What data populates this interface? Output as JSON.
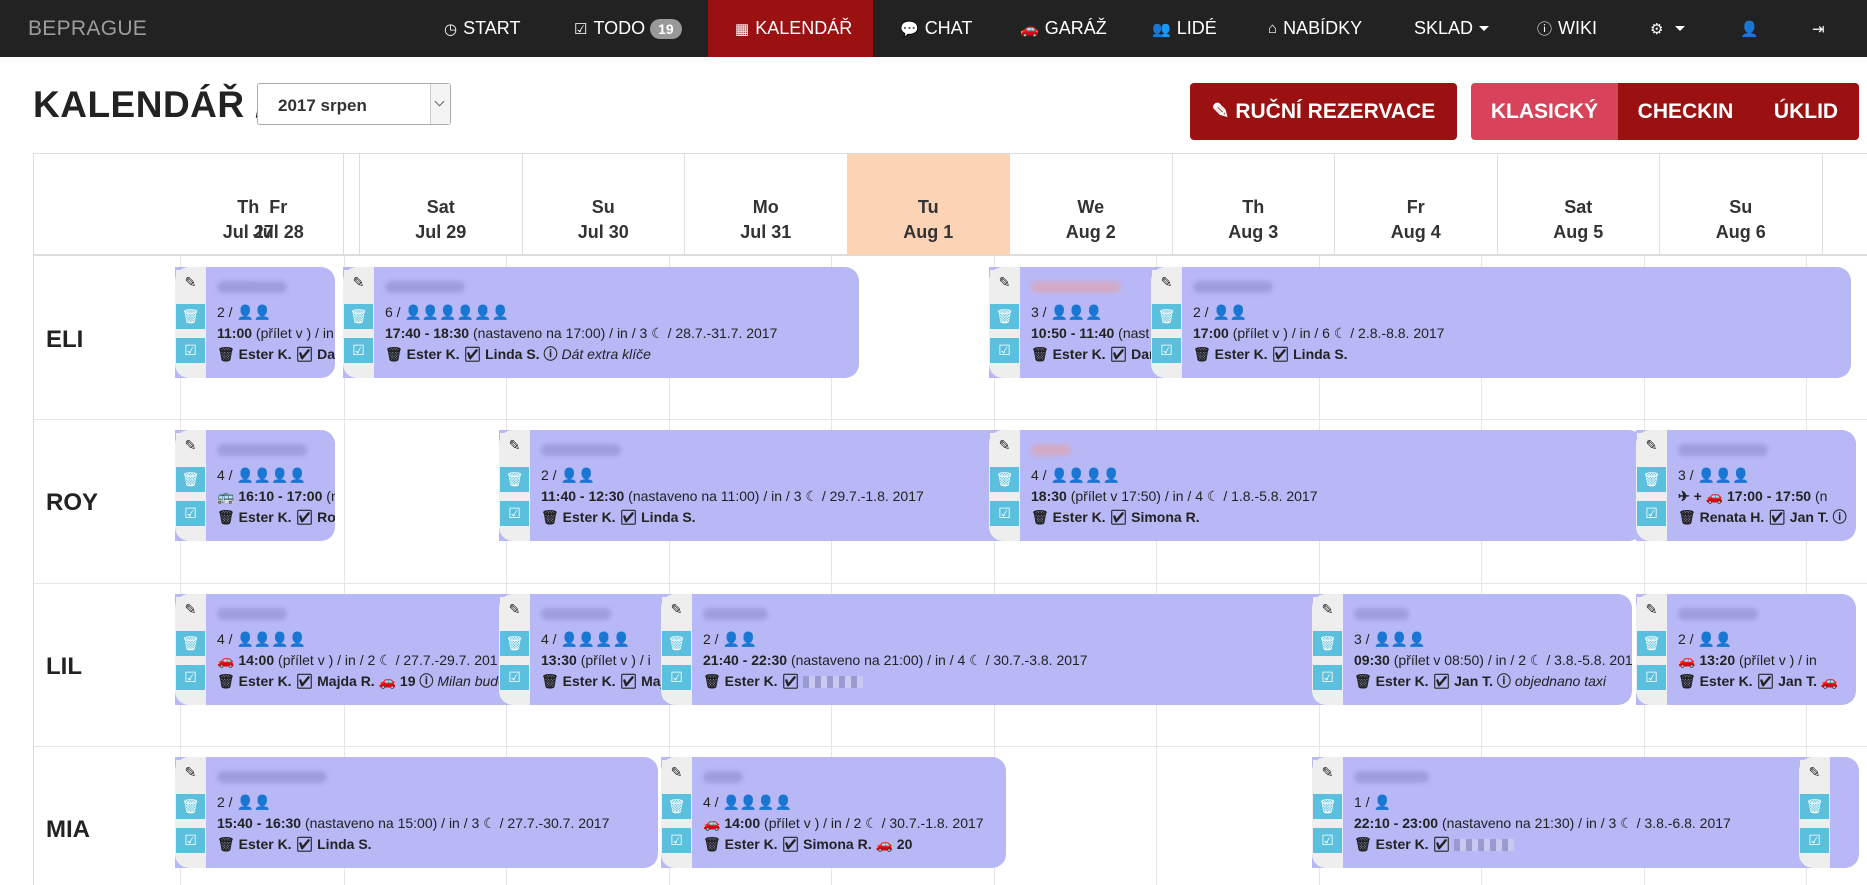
{
  "navbar": {
    "brand": "BEPRAGUE",
    "items": [
      {
        "label": "START",
        "icon": "dashboard-icon",
        "glyph": "◷"
      },
      {
        "label": "TODO",
        "icon": "checkbox-icon",
        "glyph": "☑",
        "badge": "19"
      },
      {
        "label": "KALENDÁŘ",
        "icon": "calendar-icon",
        "glyph": "▦"
      },
      {
        "label": "CHAT",
        "icon": "chat-icon",
        "glyph": "💬"
      },
      {
        "label": "GARÁŽ",
        "icon": "car-icon",
        "glyph": "🚗"
      },
      {
        "label": "LIDÉ",
        "icon": "users-icon",
        "glyph": "👥"
      },
      {
        "label": "NABÍDKY",
        "icon": "home-icon",
        "glyph": "⌂"
      },
      {
        "label": "SKLAD",
        "icon": "",
        "glyph": ""
      },
      {
        "label": "WIKI",
        "icon": "info-icon",
        "glyph": "ⓘ"
      }
    ],
    "settings_glyph": "⚙",
    "user_glyph": "👤",
    "logout_glyph": "⇥"
  },
  "header": {
    "title": "KALENDÁŘ /",
    "month_value": "2017 srpen",
    "manual_reservation": "RUČNÍ REZERVACE",
    "manual_reservation_glyph": "✎",
    "view_classic": "KLASICKÝ",
    "view_checkin": "CHECKIN",
    "view_cleaning": "ÚKLID"
  },
  "days": [
    {
      "dow": "Th",
      "date": "Jul 27"
    },
    {
      "dow": "Fr",
      "date": "Jul 28"
    },
    {
      "dow": "Sat",
      "date": "Jul 29"
    },
    {
      "dow": "Su",
      "date": "Jul 30"
    },
    {
      "dow": "Mo",
      "date": "Jul 31"
    },
    {
      "dow": "Tu",
      "date": "Aug 1"
    },
    {
      "dow": "We",
      "date": "Aug 2"
    },
    {
      "dow": "Th",
      "date": "Aug 3"
    },
    {
      "dow": "Fr",
      "date": "Aug 4"
    },
    {
      "dow": "Sat",
      "date": "Aug 5"
    },
    {
      "dow": "Su",
      "date": "Aug 6"
    }
  ],
  "resources": [
    "ELI",
    "ROY",
    "LIL",
    "MIA"
  ],
  "colors": {
    "booking": "#b8b8f7",
    "accent": "#9b1010",
    "today": "#fdd3b5",
    "action": "#5bc0de"
  },
  "bookings": [
    {
      "row": 0,
      "persons": "2 / 👤👤",
      "time": "11:00",
      "rest": " (přílet v ) / in",
      "staff": "🗑 Ester K. ☑ Darj"
    },
    {
      "row": 0,
      "persons": "6 / 👤👤👤👤👤👤",
      "time": "17:40 - 18:30",
      "rest": " (nastaveno na 17:00) / in / 3 ☾ / 28.7.-31.7. 2017",
      "staff": "🗑 Ester K. ☑ Linda S. ⓘ",
      "note": "Dát extra klíče"
    },
    {
      "row": 0,
      "persons": "3 / 👤👤👤",
      "time": "10:50 - 11:40",
      "rest": " (nast",
      "staff": "🗑 Ester K. ☑ Darj",
      "pink": true
    },
    {
      "row": 0,
      "persons": "2 / 👤👤",
      "time": "17:00",
      "rest": " (přílet v ) / in / 6 ☾ / 2.8.-8.8. 2017",
      "staff": "🗑 Ester K. ☑ Linda S."
    },
    {
      "row": 1,
      "persons": "4 / 👤👤👤👤",
      "time": "🚌 16:10 - 17:00",
      "rest": " (n",
      "staff": "🗑 Ester K. ☑ Rob"
    },
    {
      "row": 1,
      "persons": "2 / 👤👤",
      "time": "11:40 - 12:30",
      "rest": " (nastaveno na 11:00) / in / 3 ☾ / 29.7.-1.8. 2017",
      "staff": "🗑 Ester K. ☑ Linda S."
    },
    {
      "row": 1,
      "persons": "4 / 👤👤👤👤",
      "time": "18:30",
      "rest": " (přílet v 17:50) / in / 4 ☾ / 1.8.-5.8. 2017",
      "staff": "🗑 Ester K. ☑ Simona R.",
      "pink": true
    },
    {
      "row": 1,
      "persons": "3 / 👤👤👤",
      "time": "✈ + 🚗 17:00 - 17:50",
      "rest": " (n",
      "staff": "🗑 Renata H. ☑ Jan T. ⓘ"
    },
    {
      "row": 2,
      "persons": "4 / 👤👤👤👤",
      "time": "🚗 14:00",
      "rest": " (přílet v ) / in / 2 ☾ / 27.7.-29.7. 201",
      "staff": "🗑 Ester K. ☑ Majda R. 🚗 19 ⓘ",
      "note": "Milan bude"
    },
    {
      "row": 2,
      "persons": "4 / 👤👤👤👤",
      "time": "13:30",
      "rest": " (přílet v ) / i",
      "staff": "🗑 Ester K. ☑ Maj"
    },
    {
      "row": 2,
      "persons": "2 / 👤👤",
      "time": "21:40 - 22:30",
      "rest": " (nastaveno na 21:00) / in / 4 ☾ / 30.7.-3.8. 2017",
      "staff": "🗑 Ester K. ☑",
      "pixel": true
    },
    {
      "row": 2,
      "persons": "3 / 👤👤👤",
      "time": "09:30",
      "rest": " (přílet v 08:50) / in / 2 ☾ / 3.8.-5.8. 201",
      "staff": "🗑 Ester K. ☑ Jan T. ⓘ",
      "note": "objednano taxi"
    },
    {
      "row": 2,
      "persons": "2 / 👤👤",
      "time": "🚗 13:20",
      "rest": " (přílet v ) / in",
      "staff": "🗑 Ester K. ☑ Jan T. 🚗"
    },
    {
      "row": 3,
      "persons": "2 / 👤👤",
      "time": "15:40 - 16:30",
      "rest": " (nastaveno na 15:00) / in / 3 ☾ / 27.7.-30.7. 2017",
      "staff": "🗑 Ester K. ☑ Linda S."
    },
    {
      "row": 3,
      "persons": "4 / 👤👤👤👤",
      "time": "🚗 14:00",
      "rest": " (přílet v ) / in / 2 ☾ / 30.7.-1.8. 2017",
      "staff": "🗑 Ester K. ☑ Simona R. 🚗 20"
    },
    {
      "row": 3,
      "persons": "1 / 👤",
      "time": "22:10 - 23:00",
      "rest": " (nastaveno na 21:30) / in / 3 ☾ / 3.8.-6.8. 2017",
      "staff": "🗑 Ester K. ☑",
      "pixel": true
    },
    {
      "row": 3,
      "persons": "",
      "time": "",
      "rest": "",
      "staff": ""
    }
  ]
}
